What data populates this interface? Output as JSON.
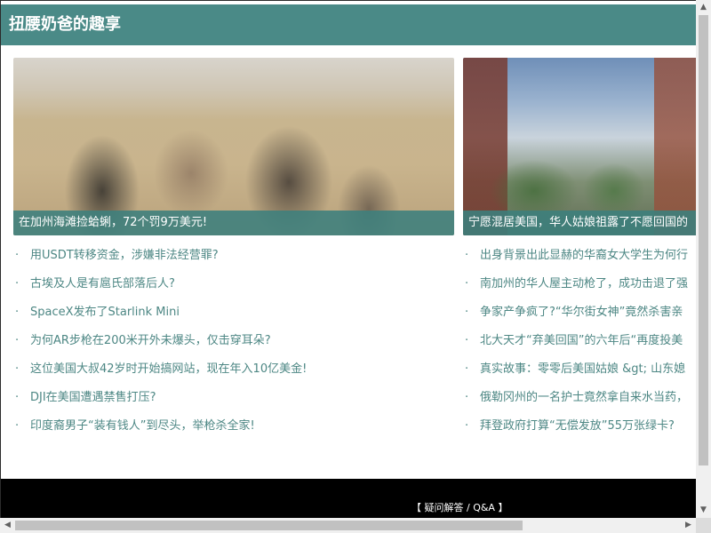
{
  "header": {
    "title": "扭腰奶爸的趣享",
    "color": "#4a8a87"
  },
  "cards": [
    {
      "caption": "在加州海滩捡蛤蜊，72个罚9万美元!"
    },
    {
      "caption": "宁愿混居美国，华人姑娘祖露了不愿回国的"
    }
  ],
  "list_left": [
    "用USDT转移资金，涉嫌非法经营罪?",
    "古埃及人是有扈氏部落后人?",
    "SpaceX发布了Starlink Mini",
    "为何AR步枪在200米开外未爆头，仅击穿耳朵?",
    "这位美国大叔42岁时开始搞网站，现在年入10亿美金!",
    "DJI在美国遭遇禁售打压?",
    "印度裔男子“装有钱人”到尽头，举枪杀全家!"
  ],
  "list_right": [
    "出身背景出此显赫的华裔女大学生为何行",
    "南加州的华人屋主动枪了，成功击退了强",
    "争家产争疯了?“华尔街女神”竟然杀害亲",
    "北大天才“弃美回国”的六年后“再度投美",
    "真实故事：零零后美国姑娘 &gt; 山东媳",
    "俄勒冈州的一名护士竟然拿自来水当药，",
    "拜登政府打算“无偿发放”55万张绿卡?"
  ],
  "bullet": "·",
  "footer": {
    "link": "【 疑问解答 / Q&A 】"
  },
  "scrollbars": {
    "up": "▲",
    "down": "▼",
    "left": "◀",
    "right": "▶"
  }
}
